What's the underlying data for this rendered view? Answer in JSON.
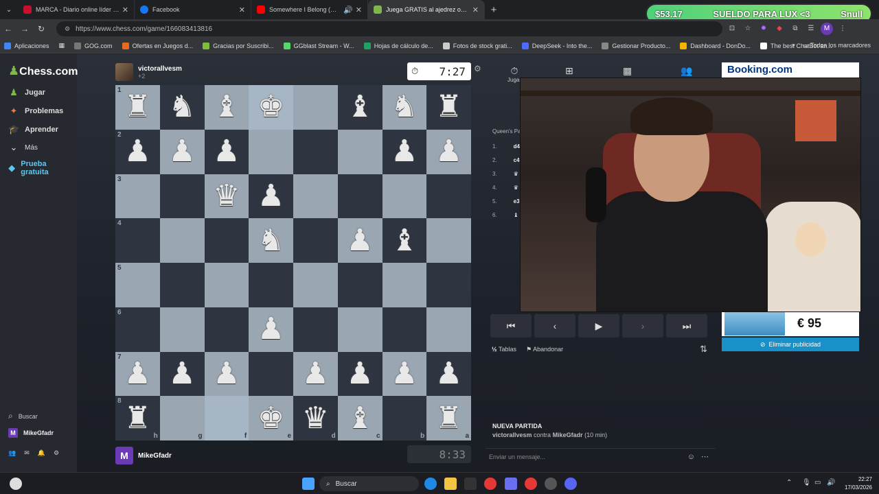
{
  "browser": {
    "tabs": [
      {
        "title": "MARCA - Diario online líder en",
        "color": "#c8102e"
      },
      {
        "title": "Facebook",
        "color": "#1877f2"
      },
      {
        "title": "Somewhere I Belong (Offici",
        "color": "#ff0000"
      },
      {
        "title": "Juega GRATIS al ajedrez online",
        "color": "#81b64c"
      }
    ],
    "url": "https://www.chess.com/game/166083413816",
    "bookmarks": [
      "Aplicaciones",
      "GOG.com",
      "Ofertas en Juegos d...",
      "Gracias por Suscribi...",
      "GGblast Stream - W...",
      "Hojas de cálculo de...",
      "Fotos de stock grati...",
      "DeepSeek - Into the...",
      "Gestionar Producto...",
      "Dashboard - DonDo...",
      "The best ChatBot an..."
    ],
    "bookmarks_right": "Todos los marcadores",
    "extension_banner": {
      "amount": "$53.17",
      "text": "SUELDO PARA LUX <3",
      "user": "Snull"
    }
  },
  "sidebar": {
    "logo": "Chess.com",
    "items": [
      "Jugar",
      "Problemas",
      "Aprender",
      "Más",
      "Prueba gratuita"
    ],
    "search": "Buscar",
    "user": "MikeGfadr"
  },
  "game": {
    "top_player": {
      "name": "victorallvesm",
      "sub": "+2",
      "clock": "7:27"
    },
    "bottom_player": {
      "name": "MikeGfadr",
      "clock": "8:33"
    },
    "board": [
      [
        "♜",
        "♞",
        "♝",
        "♚",
        "",
        "♝",
        "♞",
        "♜"
      ],
      [
        "♟",
        "♟",
        "♟",
        "",
        "",
        "",
        "♟",
        "♟"
      ],
      [
        "",
        "",
        "♛",
        "♟",
        "",
        "",
        "",
        ""
      ],
      [
        "",
        "",
        "",
        "♞",
        "",
        "♟",
        "♝",
        ""
      ],
      [
        "",
        "",
        "",
        "",
        "",
        "",
        "",
        ""
      ],
      [
        "",
        "",
        "",
        "♟",
        "",
        "",
        "",
        ""
      ],
      [
        "♟",
        "♟",
        "♟",
        "",
        "♟",
        "♟",
        "♟",
        "♟"
      ],
      [
        "♜",
        "",
        "",
        "♚",
        "♛",
        "♝",
        "",
        "♜"
      ]
    ],
    "ranks": [
      "1",
      "2",
      "3",
      "4",
      "5",
      "6",
      "7",
      "8"
    ],
    "files": [
      "h",
      "g",
      "f",
      "e",
      "d",
      "c",
      "b",
      "a"
    ],
    "opening": "Queen's Pa",
    "moves": [
      {
        "n": "1.",
        "m": "d4"
      },
      {
        "n": "2.",
        "m": "c4"
      },
      {
        "n": "3.",
        "m": "♛"
      },
      {
        "n": "4.",
        "m": "♛"
      },
      {
        "n": "5.",
        "m": "e3"
      },
      {
        "n": "6.",
        "m": "♝"
      }
    ],
    "panel_tab_label": "Jugar",
    "draw": "Tablas",
    "resign": "Abandonar",
    "new_game_title": "NUEVA PARTIDA",
    "new_game_sub_p1": "victorallvesm",
    "new_game_sub_mid": " contra ",
    "new_game_sub_p2": "MikeGfadr",
    "new_game_sub_tc": " (10 min)",
    "chat_placeholder": "Enviar un mensaje..."
  },
  "ad": {
    "brand": "Booking.com",
    "price": "€ 95",
    "remove": "Eliminar publicidad"
  },
  "taskbar": {
    "search": "Buscar",
    "time": "22:27",
    "date": "17/03/2026"
  }
}
